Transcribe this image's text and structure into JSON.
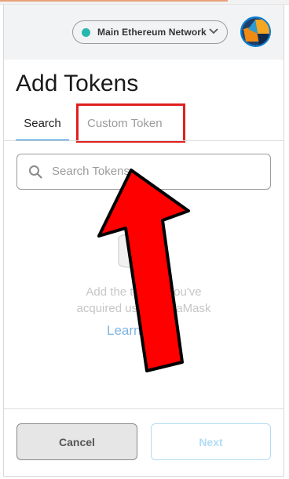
{
  "network": {
    "label": "Main Ethereum Network",
    "dot_color": "#29b6af"
  },
  "page": {
    "title": "Add Tokens"
  },
  "tabs": [
    {
      "label": "Search",
      "active": true
    },
    {
      "label": "Custom Token",
      "active": false
    }
  ],
  "search": {
    "placeholder": "Search Tokens",
    "value": ""
  },
  "empty_state": {
    "line1": "Add the tokens you've",
    "line2": "acquired using MetaMask",
    "link": "Learn more"
  },
  "footer": {
    "cancel_label": "Cancel",
    "next_label": "Next"
  },
  "colors": {
    "accent": "#037dd6",
    "highlight": "#e02020",
    "arrow": "#ff0000"
  }
}
